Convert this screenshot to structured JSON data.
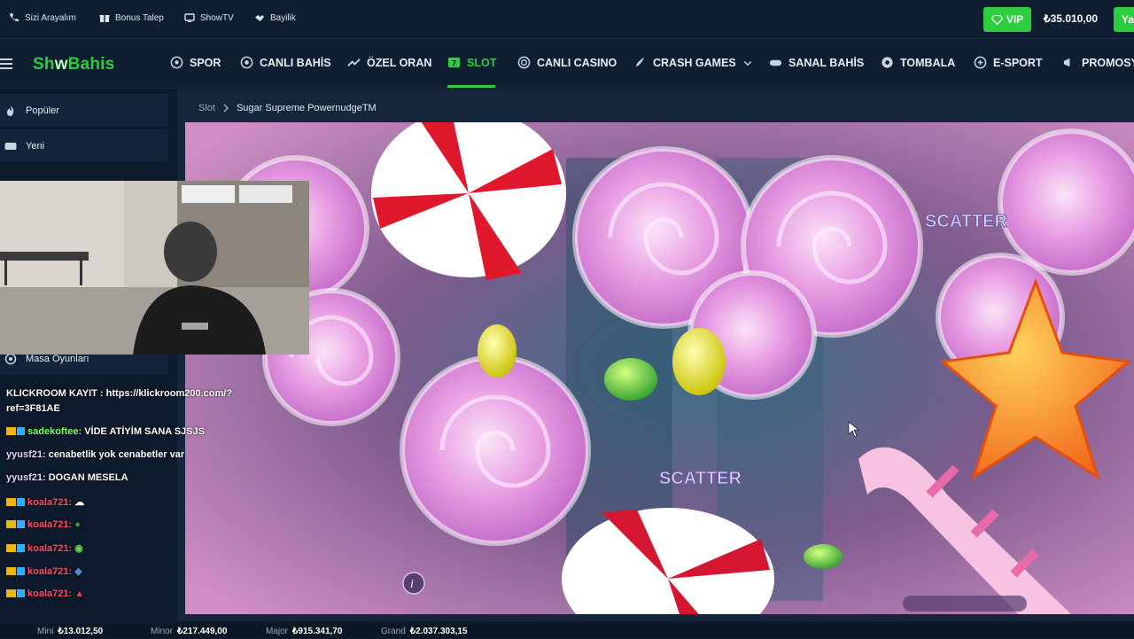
{
  "topbar": {
    "links": [
      {
        "label": "Sizi Arayalım",
        "icon": "phone-icon"
      },
      {
        "label": "Bonus Talep",
        "icon": "gift-icon"
      },
      {
        "label": "ShowTV",
        "icon": "tv-icon"
      },
      {
        "label": "Bayilik",
        "icon": "handshake-icon"
      }
    ],
    "vip_label": "VIP",
    "balance": "₺35.010,00",
    "deposit_label": "Ya"
  },
  "logo": {
    "part1": "Sh",
    "part2": "w",
    "part3": "Bahis"
  },
  "nav": {
    "items": [
      {
        "label": "SPOR",
        "icon": "soccer-ball-icon"
      },
      {
        "label": "CANLI BAHİS",
        "icon": "live-icon"
      },
      {
        "label": "ÖZEL ORAN",
        "icon": "trend-icon"
      },
      {
        "label": "SLOT",
        "icon": "slot-icon"
      },
      {
        "label": "CANLI CASINO",
        "icon": "chip-icon"
      },
      {
        "label": "CRASH GAMES",
        "icon": "rocket-icon"
      },
      {
        "label": "SANAL BAHİS",
        "icon": "gamepad-icon"
      },
      {
        "label": "TOMBALA",
        "icon": "bingo-icon"
      },
      {
        "label": "E-SPORT",
        "icon": "esport-icon"
      },
      {
        "label": "PROMOSYO",
        "icon": "megaphone-icon"
      }
    ],
    "active": "SLOT"
  },
  "sidebar": {
    "items": [
      {
        "label": "Popüler",
        "icon": "flame-icon"
      },
      {
        "label": "Yeni",
        "icon": "new-icon"
      },
      {
        "label": "Masa Oyunları",
        "icon": "table-games-icon"
      }
    ]
  },
  "breadcrumb": {
    "parent": "Slot",
    "current": "Sugar Supreme PowernudgeTM"
  },
  "chat": {
    "lines": [
      {
        "user": "",
        "text": "KLICKROOM KAYIT : https://klickroom200.com/?"
      },
      {
        "user": "",
        "text": "ref=3F81AE"
      },
      {
        "user": "sadekoftee:",
        "text": " VİDE ATİYİM SANA SJSJS"
      },
      {
        "user": "yyusf21:",
        "text": " cenabetlik yok cenabetler var"
      },
      {
        "user": "yyusf21:",
        "text": " DOGAN MESELA"
      },
      {
        "user": "koala721:",
        "text": ""
      },
      {
        "user": "koala721:",
        "text": ""
      },
      {
        "user": "koala721:",
        "text": ""
      },
      {
        "user": "koala721:",
        "text": ""
      },
      {
        "user": "koala721:",
        "text": ""
      }
    ]
  },
  "game": {
    "scatter_label": "SCATTER"
  },
  "jackpots": [
    {
      "label": "Mini",
      "value": "₺13.012,50"
    },
    {
      "label": "Minor",
      "value": "₺217.449,00"
    },
    {
      "label": "Major",
      "value": "₺915.341,70"
    },
    {
      "label": "Grand",
      "value": "₺2.037.303,15"
    }
  ],
  "colors": {
    "accent": "#2ecc40",
    "bg": "#0d1a2b",
    "panel": "#13243a"
  }
}
